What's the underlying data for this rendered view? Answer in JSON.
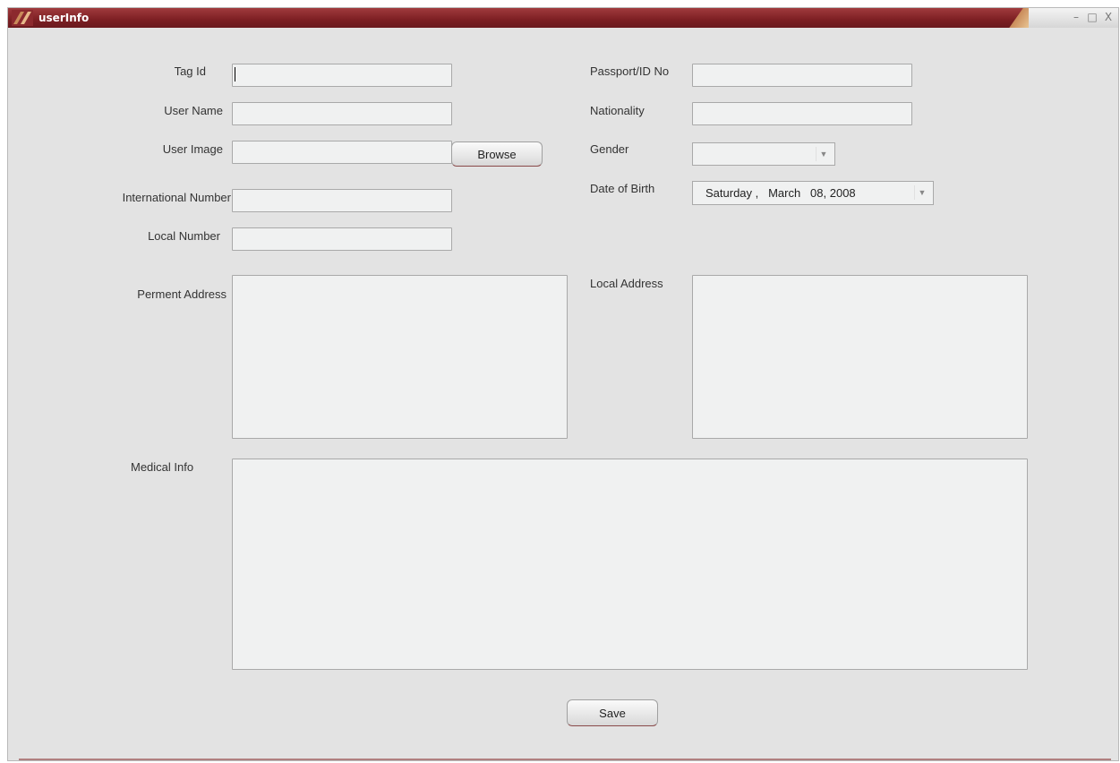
{
  "window": {
    "title": "userInfo",
    "controls": {
      "minimize": "–",
      "maximize": "□",
      "close": "X"
    }
  },
  "form": {
    "tag_id": {
      "label": "Tag Id",
      "value": ""
    },
    "user_name": {
      "label": "User Name",
      "value": ""
    },
    "user_image": {
      "label": "User Image",
      "value": "",
      "browse_label": "Browse"
    },
    "international_number": {
      "label": "International Number",
      "value": ""
    },
    "local_number": {
      "label": "Local Number",
      "value": ""
    },
    "passport_id": {
      "label": "Passport/ID No",
      "value": ""
    },
    "nationality": {
      "label": "Nationality",
      "value": ""
    },
    "gender": {
      "label": "Gender",
      "value": ""
    },
    "date_of_birth": {
      "label": "Date of Birth",
      "value": "Saturday ,   March   08, 2008"
    },
    "permanent_address": {
      "label": "Perment Address",
      "value": ""
    },
    "local_address": {
      "label": "Local Address",
      "value": ""
    },
    "medical_info": {
      "label": "Medical Info",
      "value": ""
    },
    "save_label": "Save"
  },
  "icons": {
    "app": "app-logo-icon",
    "dropdown": "chevron-down-icon"
  },
  "colors": {
    "titlebar": "#7c1f23",
    "background": "#e3e3e3",
    "field": "#f0f1f1"
  }
}
